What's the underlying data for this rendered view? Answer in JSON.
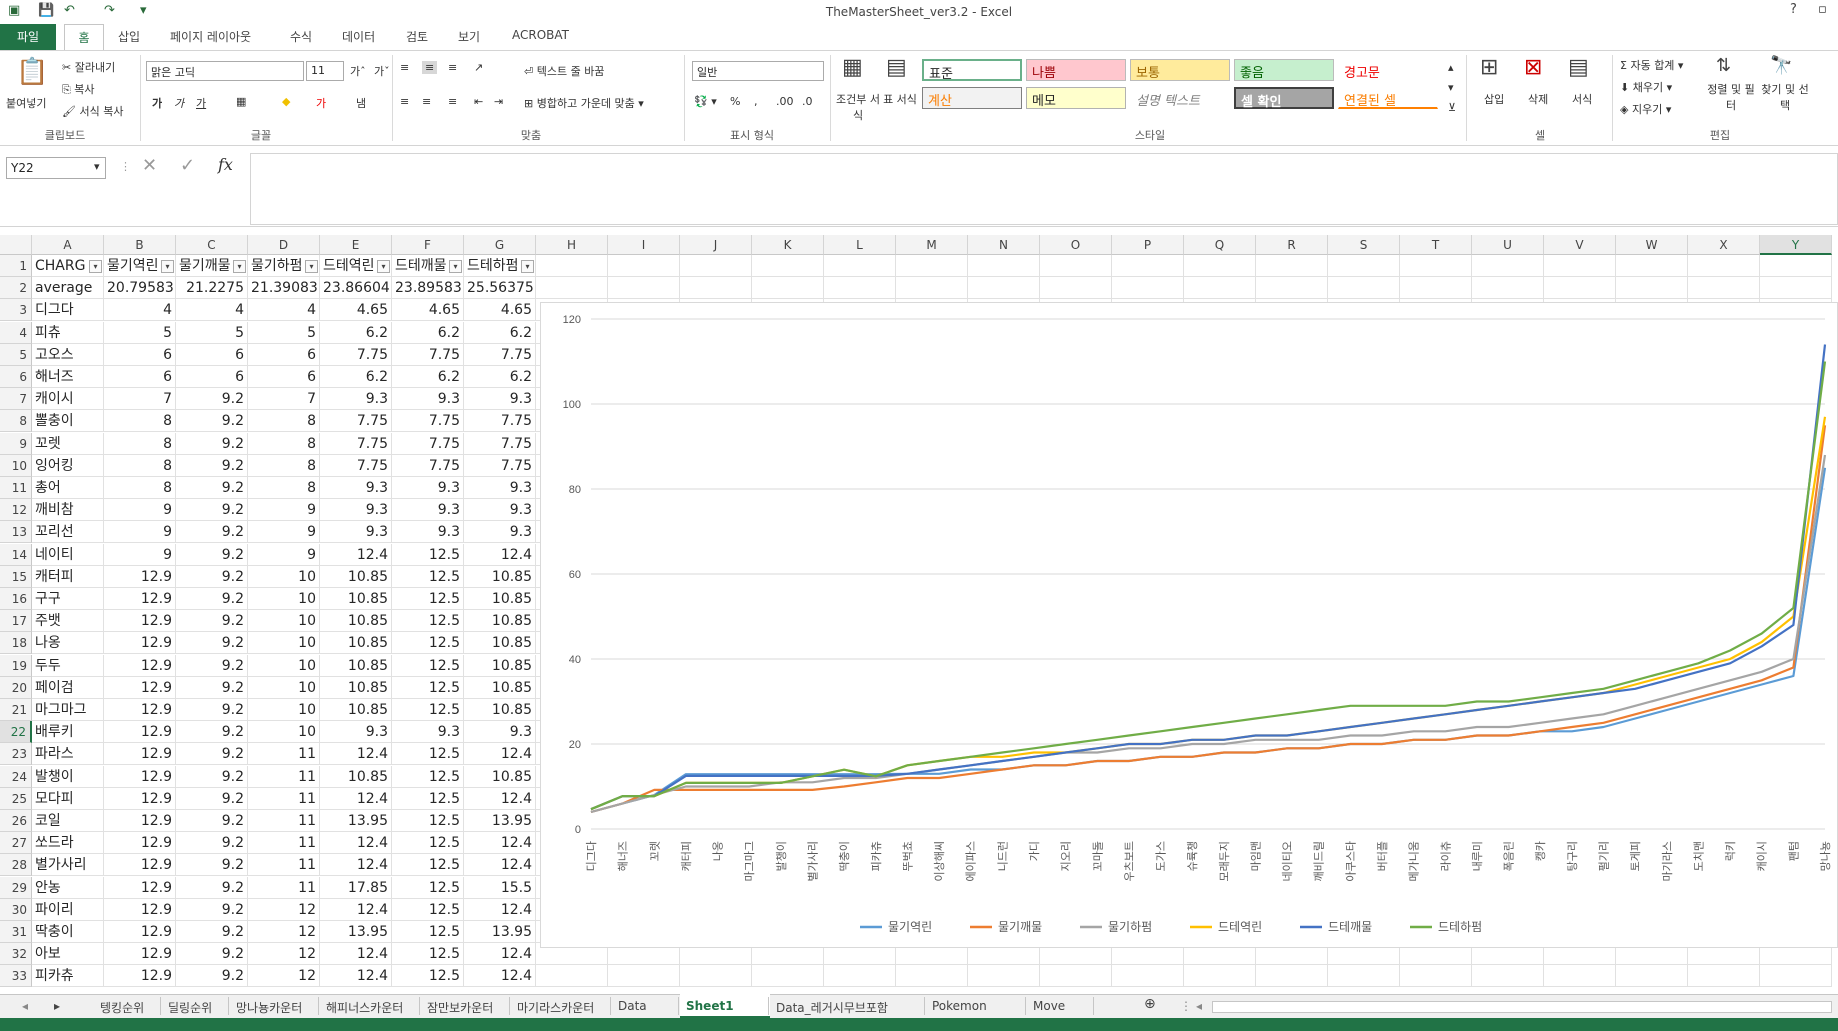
{
  "titlebar": {
    "title": "TheMasterSheet_ver3.2 - Excel",
    "help": "?"
  },
  "ribbon_tabs": [
    "파일",
    "홈",
    "삽입",
    "페이지 레이아웃",
    "수식",
    "데이터",
    "검토",
    "보기",
    "ACROBAT"
  ],
  "ribbon": {
    "clipboard": {
      "paste": "붙여넣기",
      "cut": "잘라내기",
      "copy": "복사",
      "format_painter": "서식 복사",
      "label": "클립보드"
    },
    "font": {
      "name": "맑은 고딕",
      "size": "11",
      "label": "글꼴"
    },
    "alignment": {
      "wrap": "텍스트 줄 바꿈",
      "merge": "병합하고 가운데 맞춤",
      "label": "맞춤"
    },
    "number": {
      "format": "일반",
      "label": "표시 형식"
    },
    "styles": {
      "cond_format": "조건부 서식",
      "table_format": "표 서식",
      "cells": [
        "표준",
        "나쁨",
        "보통",
        "좋음",
        "경고문",
        "계산",
        "메모",
        "설명 텍스트",
        "셀 확인",
        "연결된 셀"
      ],
      "label": "스타일"
    },
    "cells_grp": {
      "insert": "삽입",
      "delete": "삭제",
      "format": "서식",
      "label": "셀"
    },
    "editing": {
      "autosum": "자동 합계",
      "fill": "채우기",
      "clear": "지우기",
      "sort": "정렬 및 필터",
      "find": "찾기 및 선택",
      "label": "편집"
    }
  },
  "formula_bar": {
    "name_box": "Y22",
    "fx": "fx",
    "value": ""
  },
  "columns": [
    "A",
    "B",
    "C",
    "D",
    "E",
    "F",
    "G",
    "H",
    "I",
    "J",
    "K",
    "L",
    "M",
    "N",
    "O",
    "P",
    "Q",
    "R",
    "S",
    "T",
    "U",
    "V",
    "W",
    "X",
    "Y"
  ],
  "selected_column": "Y",
  "selected_row": "22",
  "header_row": [
    "CHARG",
    "물기역린",
    "물기깨물",
    "물기하펌",
    "드테역린",
    "드테깨물",
    "드테하펌"
  ],
  "rows": [
    [
      "2",
      "average",
      "20.79583",
      "21.2275",
      "21.39083",
      "23.86604",
      "23.89583",
      "25.56375"
    ],
    [
      "3",
      "디그다",
      "4",
      "4",
      "4",
      "4.65",
      "4.65",
      "4.65"
    ],
    [
      "4",
      "피츄",
      "5",
      "5",
      "5",
      "6.2",
      "6.2",
      "6.2"
    ],
    [
      "5",
      "고오스",
      "6",
      "6",
      "6",
      "7.75",
      "7.75",
      "7.75"
    ],
    [
      "6",
      "해너즈",
      "6",
      "6",
      "6",
      "6.2",
      "6.2",
      "6.2"
    ],
    [
      "7",
      "캐이시",
      "7",
      "9.2",
      "7",
      "9.3",
      "9.3",
      "9.3"
    ],
    [
      "8",
      "뽈충이",
      "8",
      "9.2",
      "8",
      "7.75",
      "7.75",
      "7.75"
    ],
    [
      "9",
      "꼬렛",
      "8",
      "9.2",
      "8",
      "7.75",
      "7.75",
      "7.75"
    ],
    [
      "10",
      "잉어킹",
      "8",
      "9.2",
      "8",
      "7.75",
      "7.75",
      "7.75"
    ],
    [
      "11",
      "총어",
      "8",
      "9.2",
      "8",
      "9.3",
      "9.3",
      "9.3"
    ],
    [
      "12",
      "깨비참",
      "9",
      "9.2",
      "9",
      "9.3",
      "9.3",
      "9.3"
    ],
    [
      "13",
      "꼬리선",
      "9",
      "9.2",
      "9",
      "9.3",
      "9.3",
      "9.3"
    ],
    [
      "14",
      "네이티",
      "9",
      "9.2",
      "9",
      "12.4",
      "12.5",
      "12.4"
    ],
    [
      "15",
      "캐터피",
      "12.9",
      "9.2",
      "10",
      "10.85",
      "12.5",
      "10.85"
    ],
    [
      "16",
      "구구",
      "12.9",
      "9.2",
      "10",
      "10.85",
      "12.5",
      "10.85"
    ],
    [
      "17",
      "주뱃",
      "12.9",
      "9.2",
      "10",
      "10.85",
      "12.5",
      "10.85"
    ],
    [
      "18",
      "나옹",
      "12.9",
      "9.2",
      "10",
      "10.85",
      "12.5",
      "10.85"
    ],
    [
      "19",
      "두두",
      "12.9",
      "9.2",
      "10",
      "10.85",
      "12.5",
      "10.85"
    ],
    [
      "20",
      "페이검",
      "12.9",
      "9.2",
      "10",
      "10.85",
      "12.5",
      "10.85"
    ],
    [
      "21",
      "마그마그",
      "12.9",
      "9.2",
      "10",
      "10.85",
      "12.5",
      "10.85"
    ],
    [
      "22",
      "배루키",
      "12.9",
      "9.2",
      "10",
      "9.3",
      "9.3",
      "9.3"
    ],
    [
      "23",
      "파라스",
      "12.9",
      "9.2",
      "11",
      "12.4",
      "12.5",
      "12.4"
    ],
    [
      "24",
      "발챙이",
      "12.9",
      "9.2",
      "11",
      "10.85",
      "12.5",
      "10.85"
    ],
    [
      "25",
      "모다피",
      "12.9",
      "9.2",
      "11",
      "12.4",
      "12.5",
      "12.4"
    ],
    [
      "26",
      "코일",
      "12.9",
      "9.2",
      "11",
      "13.95",
      "12.5",
      "13.95"
    ],
    [
      "27",
      "쏘드라",
      "12.9",
      "9.2",
      "11",
      "12.4",
      "12.5",
      "12.4"
    ],
    [
      "28",
      "별가사리",
      "12.9",
      "9.2",
      "11",
      "12.4",
      "12.5",
      "12.4"
    ],
    [
      "29",
      "안농",
      "12.9",
      "9.2",
      "11",
      "17.85",
      "12.5",
      "15.5"
    ],
    [
      "30",
      "파이리",
      "12.9",
      "9.2",
      "12",
      "12.4",
      "12.5",
      "12.4"
    ],
    [
      "31",
      "딱충이",
      "12.9",
      "9.2",
      "12",
      "13.95",
      "12.5",
      "13.95"
    ],
    [
      "32",
      "아보",
      "12.9",
      "9.2",
      "12",
      "12.4",
      "12.5",
      "12.4"
    ],
    [
      "33",
      "피카츄",
      "12.9",
      "9.2",
      "12",
      "12.4",
      "12.5",
      "12.4"
    ]
  ],
  "chart_data": {
    "type": "line",
    "ylim": [
      0,
      120
    ],
    "yticks": [
      0,
      20,
      40,
      60,
      80,
      100,
      120
    ],
    "legend_position": "bottom",
    "x": [
      "디그다",
      "해너즈",
      "꼬렛",
      "캐터피",
      "나옹",
      "마그마그",
      "발챙이",
      "별가사리",
      "딱충이",
      "피카츄",
      "뚜벅쵸",
      "이상해씨",
      "에이파스",
      "니드런",
      "가디",
      "지오리",
      "꼬마돌",
      "우츠보트",
      "도가스",
      "슈륙챙",
      "모래두지",
      "마임맨",
      "네이티오",
      "깨비드릴",
      "아쿠스타",
      "버터플",
      "메가니움",
      "라이츄",
      "내루미",
      "폭음린",
      "캥카",
      "탕구리",
      "펄기리",
      "토게피",
      "마기라스",
      "도치맨",
      "럭키",
      "캐이시",
      "팬텀",
      "망나뇽"
    ],
    "series": [
      {
        "name": "물기역린",
        "color": "#5b9bd5",
        "values": [
          4,
          6,
          8,
          12.9,
          12.9,
          12.9,
          12.9,
          12.9,
          12.9,
          12.9,
          13,
          13,
          14,
          14,
          15,
          15,
          16,
          16,
          17,
          17,
          18,
          18,
          19,
          19,
          20,
          20,
          21,
          21,
          22,
          22,
          23,
          23,
          24,
          26,
          28,
          30,
          32,
          34,
          36,
          85
        ]
      },
      {
        "name": "물기깨물",
        "color": "#ed7d31",
        "values": [
          4,
          6,
          9.2,
          9.2,
          9.2,
          9.2,
          9.2,
          9.2,
          10,
          11,
          12,
          12,
          13,
          14,
          15,
          15,
          16,
          16,
          17,
          17,
          18,
          18,
          19,
          19,
          20,
          20,
          21,
          21,
          22,
          22,
          23,
          24,
          25,
          27,
          29,
          31,
          33,
          35,
          38,
          95
        ]
      },
      {
        "name": "물기하펌",
        "color": "#a5a5a5",
        "values": [
          4,
          6,
          8,
          10,
          10,
          10,
          11,
          11,
          12,
          12,
          13,
          14,
          15,
          16,
          17,
          18,
          18,
          19,
          19,
          20,
          20,
          21,
          21,
          21,
          22,
          22,
          23,
          23,
          24,
          24,
          25,
          26,
          27,
          29,
          31,
          33,
          35,
          37,
          40,
          88
        ]
      },
      {
        "name": "드테역린",
        "color": "#ffc000",
        "values": [
          4.65,
          7.75,
          7.75,
          10.85,
          10.85,
          10.85,
          10.85,
          12.4,
          13.95,
          12.4,
          15,
          16,
          17,
          17,
          18,
          18,
          19,
          20,
          20,
          21,
          21,
          22,
          22,
          23,
          24,
          25,
          26,
          27,
          28,
          29,
          30,
          31,
          32,
          34,
          36,
          38,
          40,
          44,
          50,
          97
        ]
      },
      {
        "name": "드테깨물",
        "color": "#4472c4",
        "values": [
          4.65,
          7.75,
          7.75,
          12.5,
          12.5,
          12.5,
          12.5,
          12.5,
          12.5,
          12.5,
          13,
          14,
          15,
          16,
          17,
          18,
          19,
          20,
          20,
          21,
          21,
          22,
          22,
          23,
          24,
          25,
          26,
          27,
          28,
          29,
          30,
          31,
          32,
          33,
          35,
          37,
          39,
          43,
          48,
          114
        ]
      },
      {
        "name": "드테하펌",
        "color": "#70ad47",
        "values": [
          4.65,
          7.75,
          7.75,
          10.85,
          10.85,
          10.85,
          10.85,
          12.4,
          13.95,
          12.4,
          15,
          16,
          17,
          18,
          19,
          20,
          21,
          22,
          23,
          24,
          25,
          26,
          27,
          28,
          29,
          29,
          29,
          29,
          30,
          30,
          31,
          32,
          33,
          35,
          37,
          39,
          42,
          46,
          52,
          110
        ]
      }
    ]
  },
  "sheet_tabs": [
    "텡킹순위",
    "딜링순위",
    "망나뇽카운터",
    "해피너스카운터",
    "잠만보카운터",
    "마기라스카운터",
    "Data",
    "Sheet1",
    "Data_레거시무브포함",
    "Pokemon",
    "Move"
  ],
  "active_sheet": "Sheet1"
}
